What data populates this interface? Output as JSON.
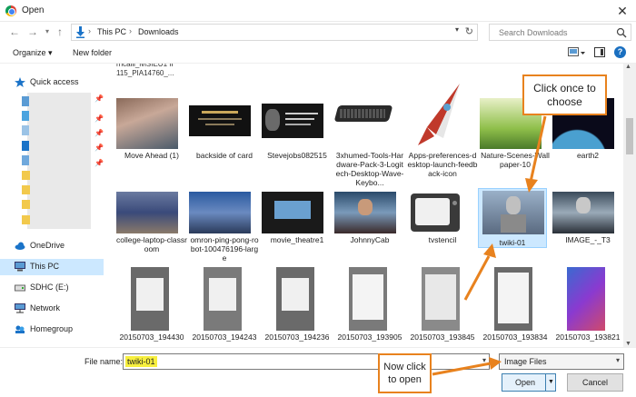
{
  "window": {
    "title": "Open",
    "close_glyph": "✕"
  },
  "address": {
    "crumbs": [
      "This PC",
      "Downloads"
    ],
    "search_placeholder": "Search Downloads"
  },
  "toolbar": {
    "organize_label": "Organize ▾",
    "new_folder_label": "New folder"
  },
  "sidebar": {
    "quick_access": "Quick access",
    "onedrive": "OneDrive",
    "this_pc": "This PC",
    "sdhc": "SDHC (E:)",
    "network": "Network",
    "homegroup": "Homegroup"
  },
  "files": {
    "partial_top_caption": "rricaiii_iviSIEU1 II 115_PIA14760_...",
    "row1": [
      "Move Ahead (1)",
      "backside of card",
      "Stevejobs082515",
      "3xhumed-Tools-Hardware-Pack-3-Logitech-Desktop-Wave-Keybo...",
      "Apps-preferences-desktop-launch-feedback-icon",
      "Nature-Scenes-Wallpaper-10",
      "earth2"
    ],
    "row2": [
      "college-laptop-classroom",
      "omron-ping-pong-robot-100476196-large",
      "movie_theatre1",
      "JohnnyCab",
      "tvstencil",
      "twiki-01",
      "IMAGE_-_T3"
    ],
    "row3": [
      "20150703_194430",
      "20150703_194243",
      "20150703_194236",
      "20150703_193905",
      "20150703_193845",
      "20150703_193834",
      "20150703_193821"
    ],
    "selected": "twiki-01"
  },
  "bottom": {
    "filename_label": "File name:",
    "filename_value": "twiki-01",
    "filter_value": "Image Files",
    "open_label": "Open",
    "cancel_label": "Cancel"
  },
  "callouts": {
    "click_once": "Click once to choose",
    "now_click": "Now click to open"
  },
  "colors": {
    "callout_border": "#e8821e",
    "selection": "#cce8ff",
    "highlight": "#f7ef3e"
  }
}
